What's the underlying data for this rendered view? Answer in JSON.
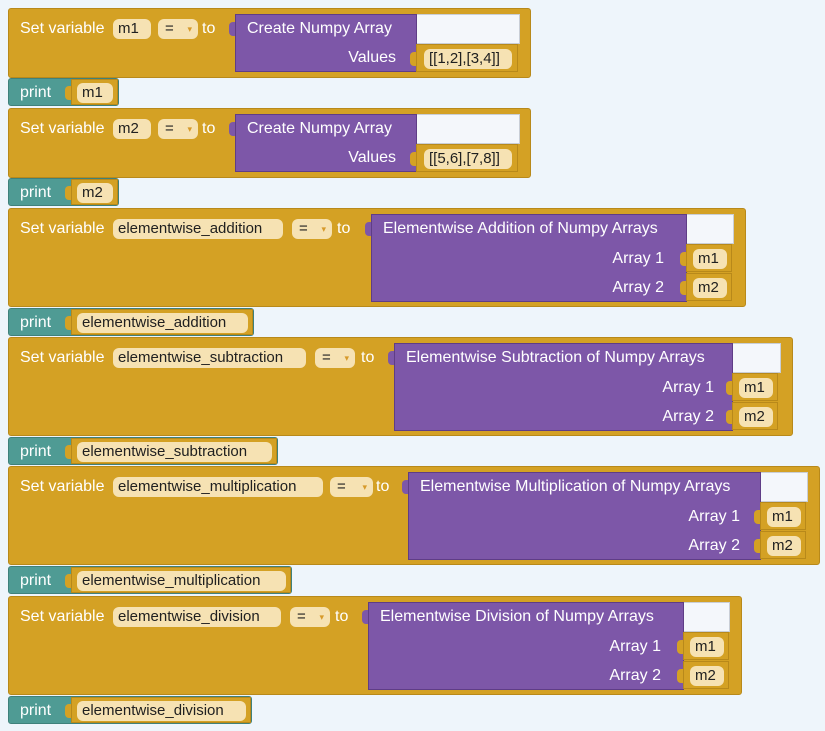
{
  "keywords": {
    "set_variable": "Set variable",
    "to": "to",
    "print": "print"
  },
  "operator": {
    "equals": "=",
    "arrow": "▾"
  },
  "blocks": {
    "m1": {
      "var": "m1",
      "func": "Create Numpy Array",
      "values_label": "Values",
      "values": "[[1,2],[3,4]]"
    },
    "m2": {
      "var": "m2",
      "func": "Create Numpy Array",
      "values_label": "Values",
      "values": "[[5,6],[7,8]]"
    },
    "add": {
      "var": "elementwise_addition",
      "func": "Elementwise Addition of Numpy Arrays",
      "arg1_label": "Array 1",
      "arg1": "m1",
      "arg2_label": "Array 2",
      "arg2": "m2"
    },
    "sub": {
      "var": "elementwise_subtraction",
      "func": "Elementwise Subtraction of Numpy Arrays",
      "arg1_label": "Array 1",
      "arg1": "m1",
      "arg2_label": "Array 2",
      "arg2": "m2"
    },
    "mul": {
      "var": "elementwise_multiplication",
      "func": "Elementwise Multiplication of Numpy Arrays",
      "arg1_label": "Array 1",
      "arg1": "m1",
      "arg2_label": "Array 2",
      "arg2": "m2"
    },
    "div": {
      "var": "elementwise_division",
      "func": "Elementwise Division of Numpy Arrays",
      "arg1_label": "Array 1",
      "arg1": "m1",
      "arg2_label": "Array 2",
      "arg2": "m2"
    }
  },
  "prints": {
    "m1": "m1",
    "m2": "m2",
    "add": "elementwise_addition",
    "sub": "elementwise_subtraction",
    "mul": "elementwise_multiplication",
    "div": "elementwise_division"
  },
  "colors": {
    "variables": "#d4a124",
    "print": "#4f9b94",
    "numpy": "#7d57a8",
    "field": "#f6e2b3",
    "workspace": "#eef5fb"
  }
}
